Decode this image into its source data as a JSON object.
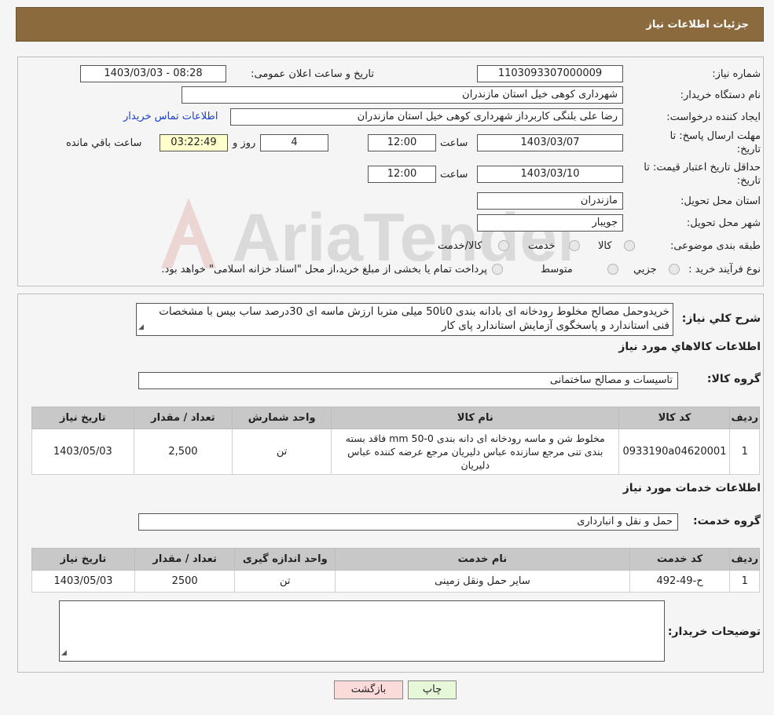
{
  "header": {
    "title": "جزئیات اطلاعات نیاز"
  },
  "fields": {
    "need_number_label": "شماره نیاز:",
    "need_number": "1103093307000009",
    "announce_label": "تاریخ و ساعت اعلان عمومی:",
    "announce_value": "1403/03/03 - 08:28",
    "buyer_org_label": "نام دستگاه خریدار:",
    "buyer_org": "شهرداری کوهی خیل استان مازندران",
    "creator_label": "ایجاد کننده درخواست:",
    "creator": "رضا علی  بلنگی  کاربرداز شهرداری کوهی خیل استان مازندران",
    "contact_link": "اطلاعات تماس خریدار",
    "deadline_label_1": "مهلت ارسال پاسخ: تا",
    "deadline_label_2": "تاریخ:",
    "deadline_date": "1403/03/07",
    "time_label": "ساعت",
    "deadline_time": "12:00",
    "days_value": "4",
    "days_label": "روز و",
    "remaining_time": "03:22:49",
    "remaining_label": "ساعت باقي مانده",
    "validity_label_1": "حداقل تاریخ اعتبار قیمت: تا",
    "validity_label_2": "تاریخ:",
    "validity_date": "1403/03/10",
    "validity_time": "12:00",
    "province_label": "استان محل تحویل:",
    "province": "مازندران",
    "city_label": "شهر محل تحویل:",
    "city": "جویبار",
    "category_label": "طبقه بندی موضوعی:",
    "category_options": [
      "کالا",
      "خدمت",
      "کالا/خدمت"
    ],
    "process_label": "نوع فرآیند خرید :",
    "process_options": [
      "جزیي",
      "متوسط"
    ],
    "process_note": "پرداخت تمام یا بخشی از مبلغ خرید،از محل \"اسناد خزانه اسلامی\" خواهد بود."
  },
  "summary": {
    "label": "شرح کلي نياز:",
    "text": "خریدوحمل مصالح مخلوط رودخانه ای بادانه بندی 0تا50 میلی متربا ارزش ماسه ای 30درصد ساب بیس با مشخصات فنی استاندارد و پاسخگوی آزمایش استاندارد پای کار"
  },
  "goods": {
    "section_title": "اطلاعات کالاهاي مورد نياز",
    "group_label": "گروه کالا:",
    "group_value": "تاسیسات و مصالح ساختمانی",
    "columns": [
      "رديف",
      "کد کالا",
      "نام کالا",
      "واحد شمارش",
      "تعداد / مقدار",
      "تاریخ نیاز"
    ],
    "rows": [
      {
        "row": "1",
        "code": "0933190a04620001",
        "name": "مخلوط شن و ماسه رودخانه ای دانه بندی mm 50-0 فاقد بسته بندی تنی مرجع سازنده عباس دلیریان مرجع عرضه کننده عباس دلیریان",
        "unit": "تن",
        "qty": "2,500",
        "date": "1403/05/03"
      }
    ]
  },
  "services": {
    "section_title": "اطلاعات خدمات مورد نياز",
    "group_label": "گروه خدمت:",
    "group_value": "حمل و نقل و انبارداری",
    "columns": [
      "رديف",
      "کد خدمت",
      "نام خدمت",
      "واحد اندازه گیری",
      "تعداد / مقدار",
      "تاریخ نیاز"
    ],
    "rows": [
      {
        "row": "1",
        "code": "ح-49-492",
        "name": "سایر حمل ونقل زمینی",
        "unit": "تن",
        "qty": "2500",
        "date": "1403/05/03"
      }
    ]
  },
  "buyer_notes": {
    "label": "توضیحات خریدار:",
    "text": ""
  },
  "buttons": {
    "print": "چاپ",
    "back": "بازگشت"
  },
  "watermark": {
    "text": "AriaTender.neT"
  },
  "colors": {
    "header_bg": "#8b6a3e",
    "timer_bg": "#ffffcc",
    "print_bg": "#e6f8d8",
    "back_bg": "#fbdada",
    "link": "#1a3fc9"
  }
}
